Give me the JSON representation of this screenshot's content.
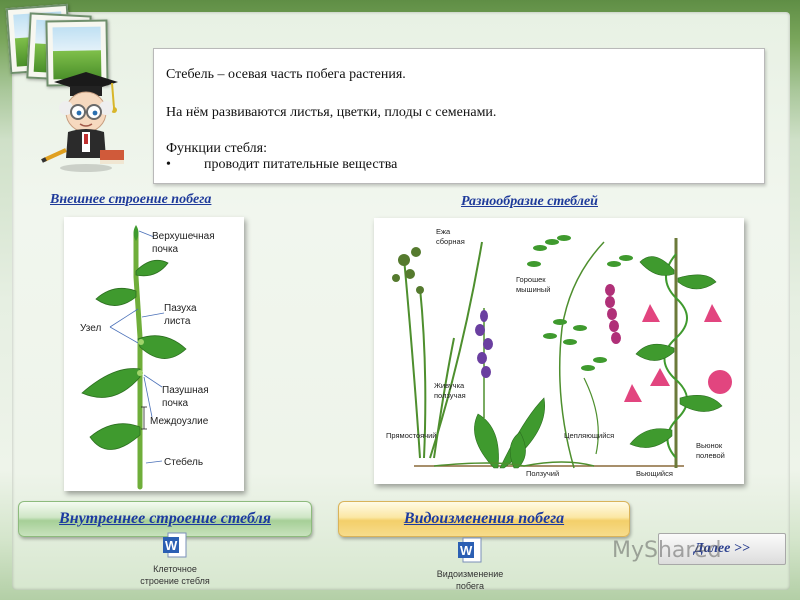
{
  "info": {
    "line1": "Стебель – осевая часть побега растения.",
    "line2": "На нём развиваются листья, цветки, плоды с семенами.",
    "line3": "Функции стебля:",
    "bullet_symbol": "•",
    "bullet1": "проводит питательные вещества"
  },
  "titles": {
    "external": "Внешнее строение побега",
    "variety": "Разнообразие стеблей"
  },
  "shoot_labels": {
    "apical_bud_1": "Верхушечная",
    "apical_bud_2": "почка",
    "axil_1": "Пазуха",
    "axil_2": "листа",
    "node": "Узел",
    "axillary_bud_1": "Пазушная",
    "axillary_bud_2": "почка",
    "internode": "Междоузлие",
    "stem": "Стебель"
  },
  "stem_labels": {
    "eja_1": "Ежа",
    "eja_2": "сборная",
    "goroshek_1": "Горошек",
    "goroshek_2": "мышиный",
    "zhivuchka_1": "Живучка",
    "zhivuchka_2": "ползучая",
    "erect": "Прямостоячий",
    "climbing": "Цепляющийся",
    "creeping": "Ползучий",
    "twining": "Вьющийся",
    "vyunok_1": "Вьюнок",
    "vyunok_2": "полевой"
  },
  "buttons": {
    "internal": "Внутреннее строение стебля",
    "modifications": "Видоизменения побега",
    "next": "Далее >>"
  },
  "documents": {
    "doc1_line1": "Клеточное",
    "doc1_line2": "строение стебля",
    "doc2_line1": "Видоизменение",
    "doc2_line2": "побега",
    "icon_letter": "W"
  },
  "watermark": "MyShared",
  "colors": {
    "link_blue": "#1e3a9a",
    "leaf_green": "#3f9a2e",
    "flower_pink": "#e2457f",
    "background_green": "#7aa65c"
  }
}
